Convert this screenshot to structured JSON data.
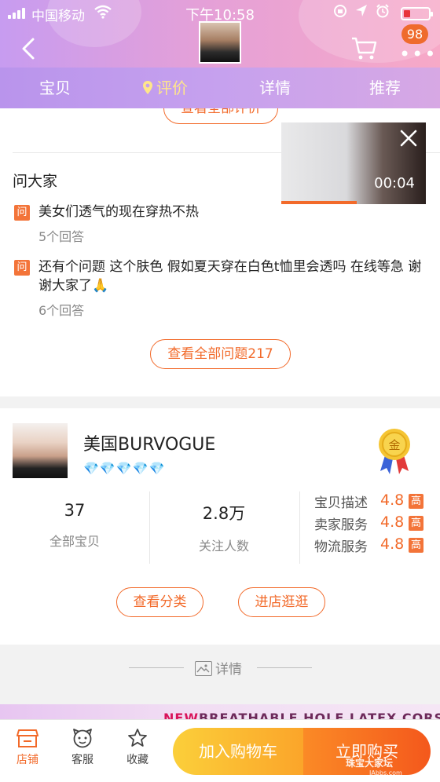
{
  "status_bar": {
    "carrier": "中国移动",
    "time": "下午10:58"
  },
  "header": {
    "cart_badge": "98"
  },
  "tabs": [
    {
      "label": "宝贝",
      "active": false
    },
    {
      "label": "评价",
      "active": true
    },
    {
      "label": "详情",
      "active": false
    },
    {
      "label": "推荐",
      "active": false
    }
  ],
  "reviews": {
    "view_all_label": "查看全部评价"
  },
  "video": {
    "time": "00:04"
  },
  "qa": {
    "title": "问大家",
    "icon_label": "问",
    "items": [
      {
        "question": "美女们透气的现在穿热不热",
        "answers": "5个回答"
      },
      {
        "question": "还有个问题 这个肤色 假如夏天穿在白色t恤里会透吗 在线等急 谢谢大家了🙏",
        "answers": "6个回答"
      }
    ],
    "view_all_label": "查看全部问题217"
  },
  "shop": {
    "name": "美国BURVOGUE",
    "diamonds": "💎💎💎💎💎",
    "medal_label": "金",
    "stats": [
      {
        "value": "37",
        "label": "全部宝贝"
      },
      {
        "value": "2.8万",
        "label": "关注人数"
      }
    ],
    "ratings": [
      {
        "label": "宝贝描述",
        "score": "4.8",
        "grade": "高"
      },
      {
        "label": "卖家服务",
        "score": "4.8",
        "grade": "高"
      },
      {
        "label": "物流服务",
        "score": "4.8",
        "grade": "高"
      }
    ],
    "category_button": "查看分类",
    "enter_shop_button": "进店逛逛"
  },
  "detail_divider": {
    "label": "详情"
  },
  "banner": {
    "prefix": "NEW",
    "text": "BREATHABLE HOLE LATEX CORSET"
  },
  "bottom_bar": {
    "shop_label": "店铺",
    "service_label": "客服",
    "favorite_label": "收藏",
    "add_to_cart": "加入购物车",
    "buy_now": "立即购买",
    "watermark": "珠宝大家坛",
    "watermark_sub": "IAbbs.com"
  },
  "colors": {
    "accent": "#f26a2a",
    "tab_active": "#ffe68a",
    "header_gradient_start": "#c79cf0",
    "header_gradient_end": "#f7a9c7"
  }
}
